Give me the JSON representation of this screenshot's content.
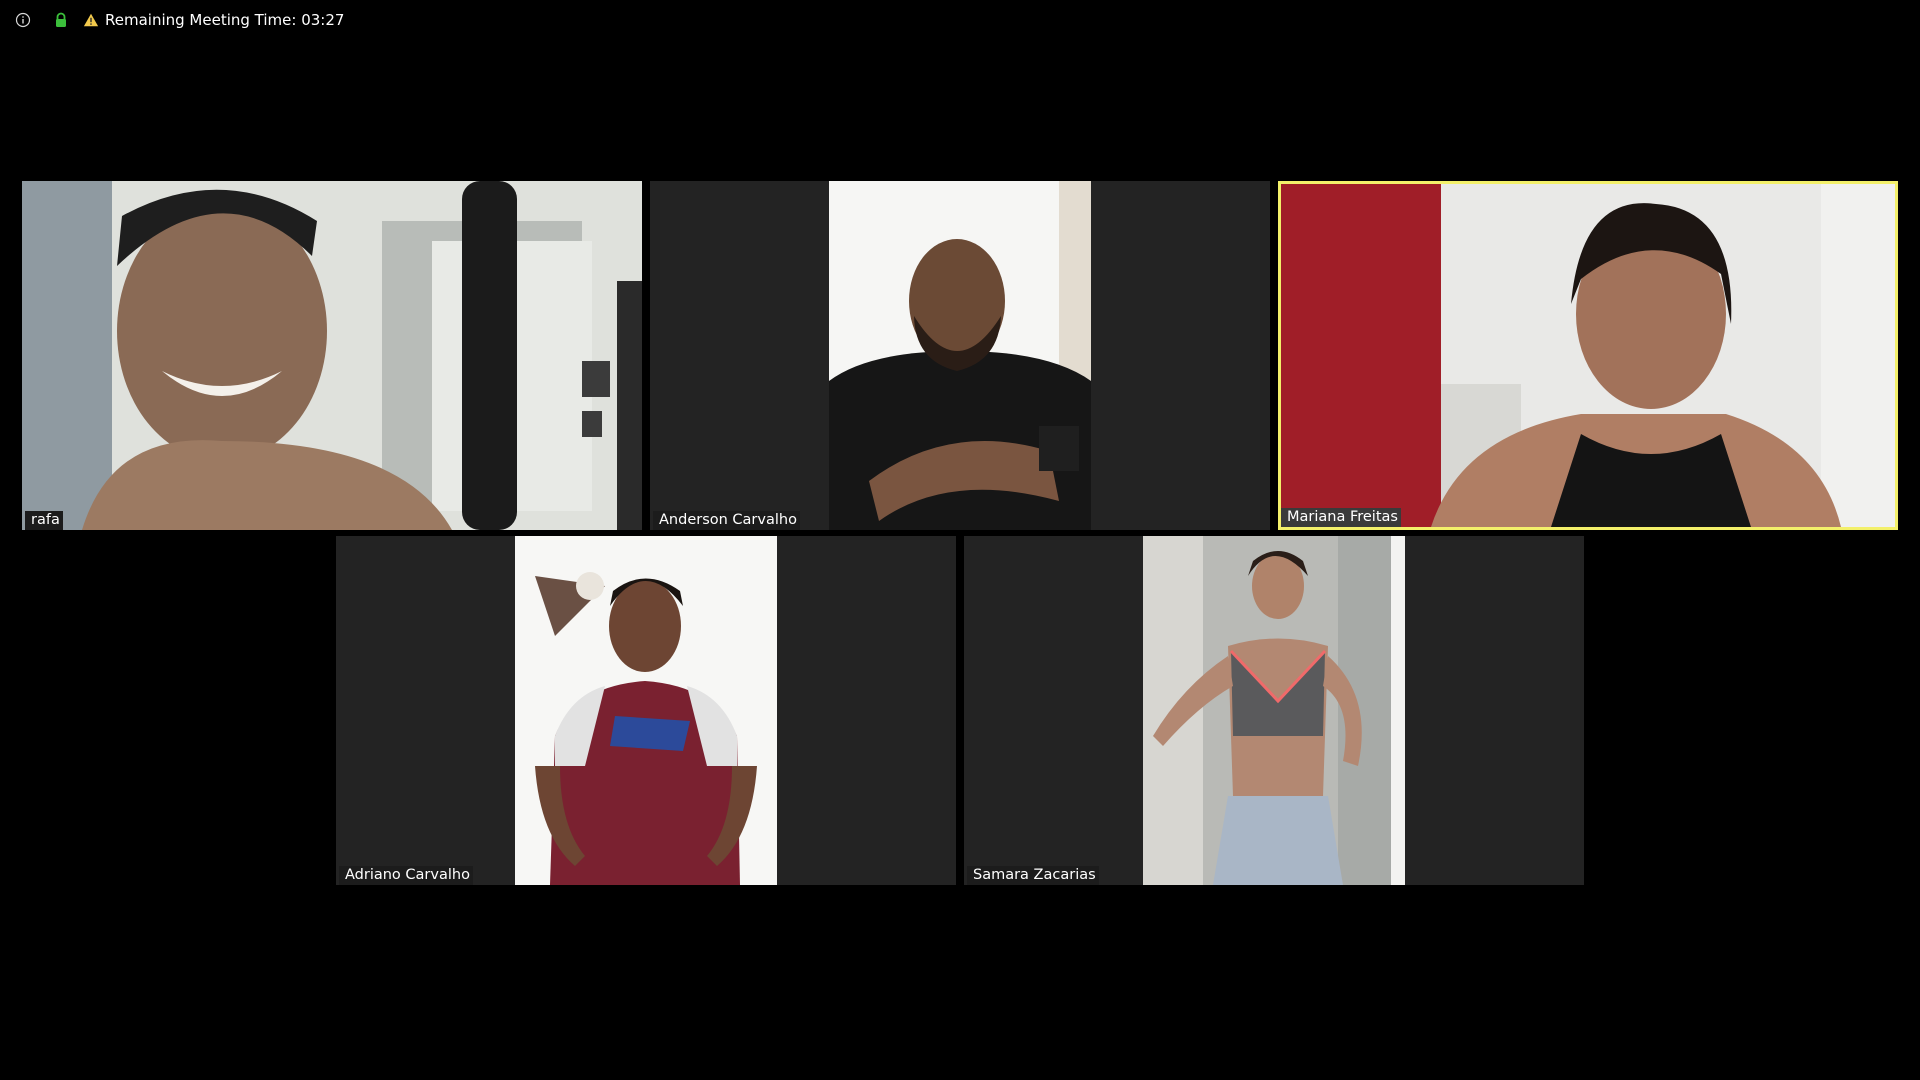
{
  "topbar": {
    "timer_label": "Remaining Meeting Time: 03:27",
    "icons": [
      "info-icon",
      "lock-icon",
      "warning-icon"
    ]
  },
  "participants": [
    {
      "name": "rafa",
      "active": false
    },
    {
      "name": "Anderson Carvalho",
      "active": false
    },
    {
      "name": "Mariana Freitas",
      "active": true
    },
    {
      "name": "Adriano Carvalho",
      "active": false
    },
    {
      "name": "Samara Zacarias",
      "active": false
    }
  ],
  "colors": {
    "background": "#000000",
    "tile_background": "#232323",
    "active_speaker_border": "#f3f06a",
    "lock_green": "#3bbf3b",
    "warning_yellow": "#f2c94c"
  }
}
